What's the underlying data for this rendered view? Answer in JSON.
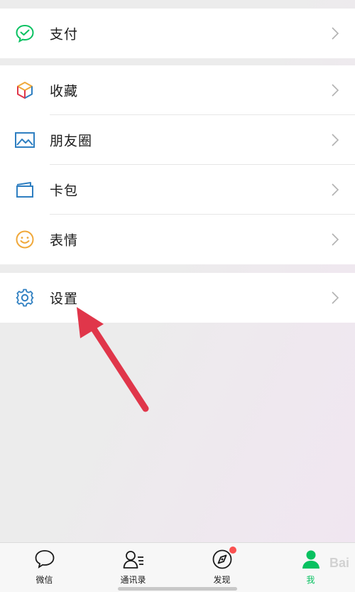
{
  "menu": {
    "group1": [
      {
        "label": "支付",
        "icon": "wechat-pay-icon"
      }
    ],
    "group2": [
      {
        "label": "收藏",
        "icon": "favorites-cube-icon"
      },
      {
        "label": "朋友圈",
        "icon": "moments-image-icon"
      },
      {
        "label": "卡包",
        "icon": "card-wallet-icon"
      },
      {
        "label": "表情",
        "icon": "smiley-icon"
      }
    ],
    "group3": [
      {
        "label": "设置",
        "icon": "gear-icon"
      }
    ]
  },
  "tabbar": {
    "tabs": [
      {
        "label": "微信",
        "icon": "chat-bubble-icon"
      },
      {
        "label": "通讯录",
        "icon": "contacts-icon"
      },
      {
        "label": "发现",
        "icon": "compass-icon"
      },
      {
        "label": "我",
        "icon": "me-person-icon",
        "active": true
      }
    ]
  },
  "watermark": {
    "text": "Bai"
  },
  "colors": {
    "accent": "#07c160",
    "badge": "#fa5151",
    "arrow": "#e0364a",
    "icon_blue": "#2f7fc1",
    "icon_orange": "#f0a83a"
  }
}
